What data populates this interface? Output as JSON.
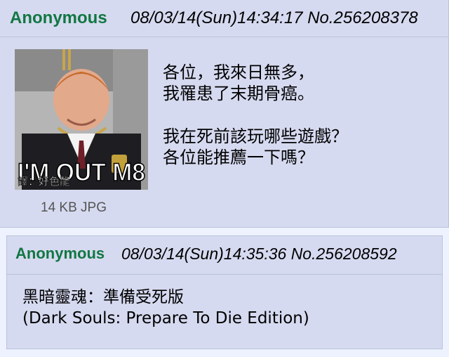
{
  "posts": [
    {
      "name": "Anonymous",
      "meta": "08/03/14(Sun)14:34:17 No.256208378",
      "image": {
        "caption_big": "I'M OUT M8",
        "caption_small": "譯：好色龍"
      },
      "file_info": "14 KB JPG",
      "lines": [
        "各位，我來日無多，",
        "我罹患了末期骨癌。",
        "",
        "我在死前該玩哪些遊戲？",
        "各位能推薦一下嗎？"
      ]
    },
    {
      "name": "Anonymous",
      "meta": "08/03/14(Sun)14:35:36 No.256208592",
      "lines": [
        "黑暗靈魂：準備受死版",
        "(Dark Souls: Prepare To Die Edition)"
      ]
    }
  ],
  "colors": {
    "name_green": "#117743",
    "post_bg": "#d6daf0",
    "page_bg": "#eef2ff",
    "border": "#b7c5d9"
  }
}
